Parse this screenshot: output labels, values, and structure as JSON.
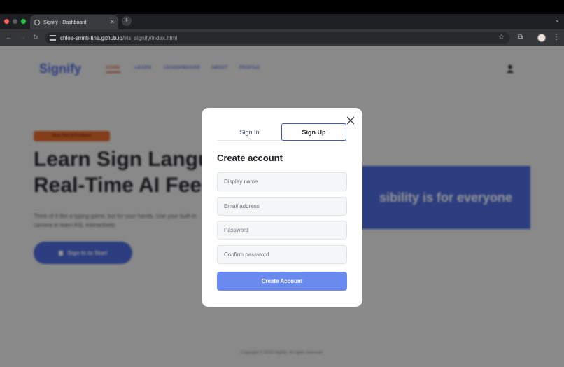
{
  "browser": {
    "tab_title": "Signify - Dashboard",
    "tab_close": "×",
    "new_tab": "+",
    "url_domain": "chloe-smriti-tina.github.io",
    "url_path": "/iris_signify/index.html"
  },
  "site": {
    "logo": "Signify",
    "nav": [
      "HOME",
      "LEARN",
      "LEADERBOARD",
      "ABOUT",
      "PROFILE"
    ],
    "badge": "Real-Time AI Feedback",
    "hero_line1": "Learn Sign Langua",
    "hero_line2": "Real-Time AI Feed",
    "hero_desc": "Think of it like a typing game, but for your hands. Use your built-in camera to learn ASL interactively.",
    "cta": "Sign In to Start",
    "banner": "sibility is for everyone",
    "footer": "Copyright © 2025 Signify. All rights reserved."
  },
  "modal": {
    "tab_signin": "Sign In",
    "tab_signup": "Sign Up",
    "title": "Create account",
    "display_name_placeholder": "Display name",
    "email_placeholder": "Email address",
    "password_placeholder": "Password",
    "confirm_placeholder": "Confirm password",
    "submit": "Create Account"
  },
  "colors": {
    "accent": "#4d6bdc",
    "submit": "#6b8af0",
    "badge": "#e46b2b"
  }
}
